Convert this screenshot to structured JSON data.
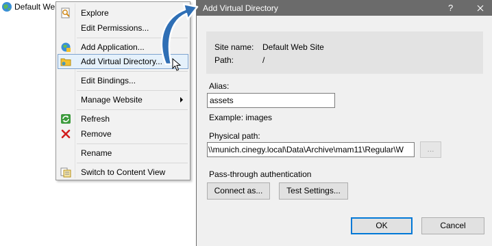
{
  "tree": {
    "node_label": "Default Web Site"
  },
  "context_menu": {
    "items": [
      {
        "label": "Explore",
        "icon": "explore-icon"
      },
      {
        "label": "Edit Permissions...",
        "icon": ""
      },
      {
        "label": "Add Application...",
        "icon": "add-application-icon"
      },
      {
        "label": "Add Virtual Directory...",
        "icon": "add-virtual-directory-icon",
        "highlighted": true
      },
      {
        "label": "Edit Bindings...",
        "icon": ""
      },
      {
        "label": "Manage Website",
        "icon": "",
        "has_submenu": true
      },
      {
        "label": "Refresh",
        "icon": "refresh-icon"
      },
      {
        "label": "Remove",
        "icon": "remove-icon"
      },
      {
        "label": "Rename",
        "icon": ""
      },
      {
        "label": "Switch to Content View",
        "icon": "content-view-icon"
      }
    ]
  },
  "dialog": {
    "title": "Add Virtual Directory",
    "help_label": "?",
    "site_name_label": "Site name:",
    "site_name_value": "Default Web Site",
    "path_label": "Path:",
    "path_value": "/",
    "alias_label": "Alias:",
    "alias_value": "assets",
    "example_text": "Example: images",
    "physical_path_label": "Physical path:",
    "physical_path_value": "\\\\munich.cinegy.local\\Data\\Archive\\mam11\\Regular\\W",
    "browse_label": "...",
    "passthrough_label": "Pass-through authentication",
    "connect_as_label": "Connect as...",
    "test_settings_label": "Test Settings...",
    "ok_label": "OK",
    "cancel_label": "Cancel"
  },
  "colors": {
    "titlebar": "#6b6b6b",
    "highlight_fill": "#e5f1fb",
    "highlight_border": "#7da2ce",
    "arrow": "#2f6fb5",
    "primary_border": "#0078d7"
  }
}
